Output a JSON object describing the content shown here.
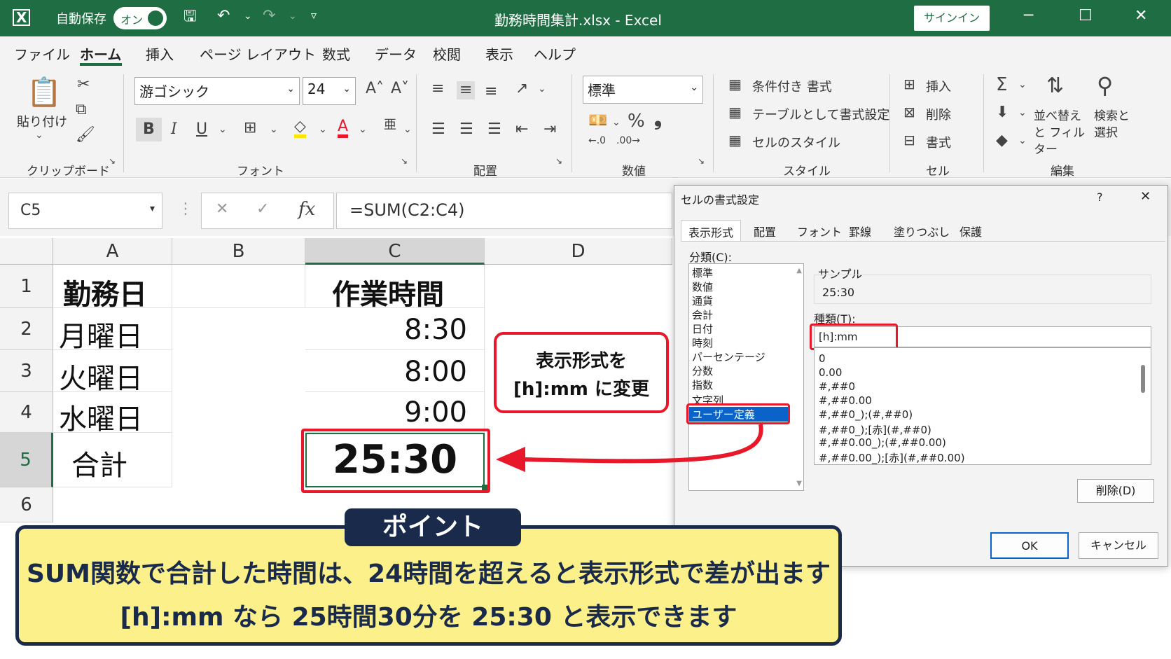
{
  "titlebar": {
    "autosave_label": "自動保存",
    "toggle_label": "オン",
    "title": "勤務時間集計.xlsx  -  Excel",
    "signin": "サインイン",
    "bg": "#1f6e43"
  },
  "menu": {
    "items": [
      "ファイル",
      "ホーム",
      "挿入",
      "ページ レイアウト",
      "数式",
      "データ",
      "校閲",
      "表示",
      "ヘルプ"
    ],
    "active": "ホーム"
  },
  "ribbon": {
    "clipboard": {
      "paste": "貼り付け",
      "label": "クリップボード"
    },
    "font": {
      "name": "游ゴシック",
      "size": "24",
      "bold": "B",
      "italic": "I",
      "underline": "U",
      "label": "フォント"
    },
    "align": {
      "label": "配置"
    },
    "number": {
      "format": "標準",
      "percent": "%",
      "comma": "❟",
      "label": "数値"
    },
    "styles": {
      "conditional": "条件付き 書式",
      "table": "テーブルとして書式設定",
      "cell": "セルのスタイル",
      "label": "スタイル"
    },
    "cells": {
      "insert": "挿入",
      "delete": "削除",
      "format": "書式",
      "label": "セル"
    },
    "edit": {
      "sort": "並べ替えと フィルター",
      "find": "検索と 選択",
      "label": "編集"
    }
  },
  "formula_bar": {
    "name_box": "C5",
    "formula": "=SUM(C2:C4)"
  },
  "sheet": {
    "columns": [
      "A",
      "B",
      "C",
      "D"
    ],
    "rows": [
      "1",
      "2",
      "3",
      "4",
      "5",
      "6"
    ],
    "cells": {
      "A1": "勤務日",
      "C1": "作業時間",
      "A2": "月曜日",
      "C2": "8:30",
      "A3": "火曜日",
      "C3": "8:00",
      "A4": "水曜日",
      "C4": "9:00",
      "A5": "合計",
      "C5": "25:30"
    }
  },
  "dialog": {
    "title": "セルの書式設定",
    "help": "?",
    "close": "✕",
    "tabs": [
      "表示形式",
      "配置",
      "フォント",
      "罫線",
      "塗りつぶし",
      "保護"
    ],
    "category_label": "分類(C):",
    "categories": [
      "標準",
      "数値",
      "通貨",
      "会計",
      "日付",
      "時刻",
      "パーセンテージ",
      "分数",
      "指数",
      "文字列",
      "ユーザー定義"
    ],
    "selected_category": "ユーザー定義",
    "sample_label": "サンプル",
    "sample_value": "25:30",
    "type_label": "種類(T):",
    "type_value": "[h]:mm",
    "type_list": [
      "0",
      "0.00",
      "#,##0",
      "#,##0.00",
      "#,##0_);(#,##0)",
      "#,##0_);[赤](#,##0)",
      "#,##0.00_);(#,##0.00)",
      "#,##0.00_);[赤](#,##0.00)"
    ],
    "delete_btn": "削除(D)",
    "ok_btn": "OK",
    "cancel_btn": "キャンセル"
  },
  "callout": {
    "line1": "表示形式を",
    "line2": "[h]:mm に変更"
  },
  "point": {
    "tag": "ポイント",
    "line1": "SUM関数で合計した時間は、24時間を超えると表示形式で差が出ます",
    "line2": "[h]:mm なら 25時間30分を 25:30 と表示できます"
  },
  "colors": {
    "highlight_red": "#e8182a",
    "point_bg": "#fbf08a",
    "point_border": "#1a2a4a",
    "selection_blue": "#0a63c9"
  }
}
